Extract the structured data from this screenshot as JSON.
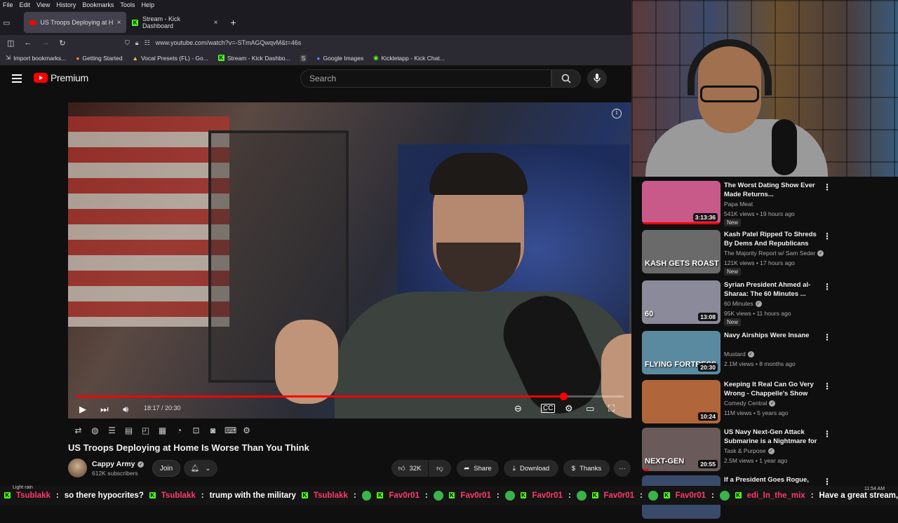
{
  "menubar": [
    "File",
    "Edit",
    "View",
    "History",
    "Bookmarks",
    "Tools",
    "Help"
  ],
  "tabs": [
    {
      "title": "US Troops Deploying at Home",
      "active": true
    },
    {
      "title": "Stream - Kick Dashboard",
      "active": false
    }
  ],
  "tab_close": "×",
  "new_tab": "+",
  "url": "www.youtube.com/watch?v=-STmAGQwqvM&t=46s",
  "bookmarks": [
    "Import bookmarks...",
    "Getting Started",
    "Vocal Presets (FL) - Go...",
    "Stream - Kick Dashbo...",
    "S",
    "Google Images",
    "Kickletapp - Kick Chat..."
  ],
  "youtube": {
    "brand": "Premium",
    "search_placeholder": "Search"
  },
  "player": {
    "time": "18:17 / 20:30",
    "progress": 0.89,
    "info": "i"
  },
  "video": {
    "title": "US Troops Deploying at Home Is Worse Than You Think",
    "channel": "Cappy Army",
    "subscribers": "612K subscribers",
    "join": "Join",
    "likes": "32K",
    "share": "Share",
    "download": "Download",
    "thanks": "Thanks",
    "more": "···"
  },
  "recommendations": [
    {
      "title": "The Worst Dating Show Ever Made Returns...",
      "channel": "Papa Meat",
      "verified": false,
      "meta": "541K views • 19 hours ago",
      "new": "New",
      "duration": "3:13:36",
      "thumb_color": "#c85a8a",
      "thumb_text": "",
      "watched": 1.0
    },
    {
      "title": "Kash Patel Ripped To Shreds By Dems And Republicans",
      "channel": "The Majority Report w/ Sam Seder",
      "verified": true,
      "meta": "121K views • 17 hours ago",
      "new": "New",
      "duration": "",
      "thumb_color": "#6a6a6a",
      "thumb_text": "KASH GETS ROAST",
      "watched": 0.0
    },
    {
      "title": "Syrian President Ahmed al-Sharaa: The 60 Minutes ...",
      "channel": "60 Minutes",
      "verified": true,
      "meta": "95K views • 11 hours ago",
      "new": "New",
      "duration": "13:08",
      "thumb_color": "#8a8a9a",
      "thumb_text": "60",
      "watched": 0.0
    },
    {
      "title": "Navy Airships Were Insane",
      "channel": "Mustard",
      "verified": true,
      "meta": "2.1M views • 8 months ago",
      "new": "",
      "duration": "20:30",
      "thumb_color": "#5a8aa0",
      "thumb_text": "FLYING FORTRESS",
      "watched": 0.0
    },
    {
      "title": "Keeping It Real Can Go Very Wrong - Chappelle's Show",
      "channel": "Comedy Central",
      "verified": true,
      "meta": "11M views • 5 years ago",
      "new": "",
      "duration": "10:24",
      "thumb_color": "#b0663a",
      "thumb_text": "",
      "watched": 0.0
    },
    {
      "title": "US Navy Next-Gen Attack Submarine is a Nightmare for ...",
      "channel": "Task & Purpose",
      "verified": true,
      "meta": "2.5M views • 1 year ago",
      "new": "",
      "duration": "20:55",
      "thumb_color": "#6a5a5a",
      "thumb_text": "NEXT-GEN",
      "watched": 0.08
    },
    {
      "title": "If a President Goes Rogue, What",
      "channel": "",
      "verified": false,
      "meta": "",
      "new": "",
      "duration": "",
      "thumb_color": "#3a4a6a",
      "thumb_text": "",
      "watched": 0.0
    }
  ],
  "ticker": {
    "weather": "Light rain",
    "clock": "11:54 AM",
    "messages": [
      {
        "user": "Tsublakk",
        "text": "so there hypocrites?"
      },
      {
        "user": "Tsublakk",
        "text": "trump with the military"
      },
      {
        "user": "Tsublakk",
        "text": ""
      },
      {
        "user": "Fav0r01",
        "text": ""
      },
      {
        "user": "Fav0r01",
        "text": ""
      },
      {
        "user": "Fav0r01",
        "text": ""
      },
      {
        "user": "Fav0r01",
        "text": ""
      },
      {
        "user": "Fav0r01",
        "text": ""
      },
      {
        "user": "edi_In_the_mix",
        "text": "Have a great stream,"
      }
    ]
  }
}
